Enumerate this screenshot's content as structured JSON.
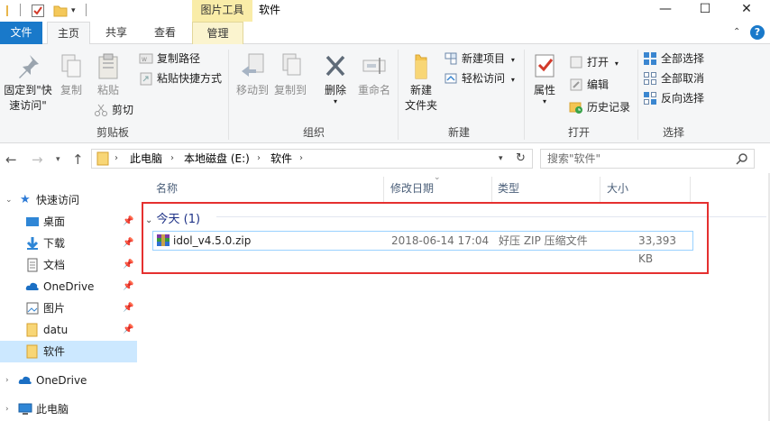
{
  "titlebar": {
    "context_tab_label": "图片工具",
    "window_title": "软件",
    "minimize": "—",
    "maximize": "☐",
    "close": "✕"
  },
  "tabs": {
    "file": "文件",
    "home": "主页",
    "share": "共享",
    "view": "查看",
    "manage": "管理"
  },
  "ribbon": {
    "clipboard": {
      "pin_quick_access": "固定到\"快\n速访问\"",
      "copy": "复制",
      "paste": "粘贴",
      "copy_path": "复制路径",
      "paste_shortcut": "粘贴快捷方式",
      "cut": "剪切",
      "label": "剪贴板"
    },
    "organize": {
      "move_to": "移动到",
      "copy_to": "复制到",
      "delete": "删除",
      "rename": "重命名",
      "label": "组织"
    },
    "new": {
      "new_folder": "新建\n文件夹",
      "new_item": "新建项目",
      "easy_access": "轻松访问",
      "label": "新建"
    },
    "open": {
      "properties": "属性",
      "open": "打开",
      "edit": "编辑",
      "history": "历史记录",
      "label": "打开"
    },
    "select": {
      "select_all": "全部选择",
      "select_none": "全部取消",
      "invert": "反向选择",
      "label": "选择"
    }
  },
  "address": {
    "crumbs": [
      "此电脑",
      "本地磁盘 (E:)",
      "软件"
    ],
    "search_placeholder": "搜索\"软件\""
  },
  "navpane": {
    "quick_access": "快速访问",
    "items": [
      "桌面",
      "下载",
      "文档",
      "OneDrive",
      "图片",
      "datu",
      "软件"
    ],
    "onedrive": "OneDrive",
    "this_pc": "此电脑"
  },
  "columns": {
    "name": "名称",
    "modified": "修改日期",
    "type": "类型",
    "size": "大小"
  },
  "group": {
    "title": "今天 (1)"
  },
  "files": [
    {
      "name": "idol_v4.5.0.zip",
      "modified": "2018-06-14 17:04",
      "type": "好压 ZIP 压缩文件",
      "size": "33,393 KB"
    }
  ],
  "colors": {
    "accent": "#1979ca",
    "context_tab": "#f9eca8",
    "selection": "#cce8ff",
    "highlight_box": "#e5302f"
  }
}
